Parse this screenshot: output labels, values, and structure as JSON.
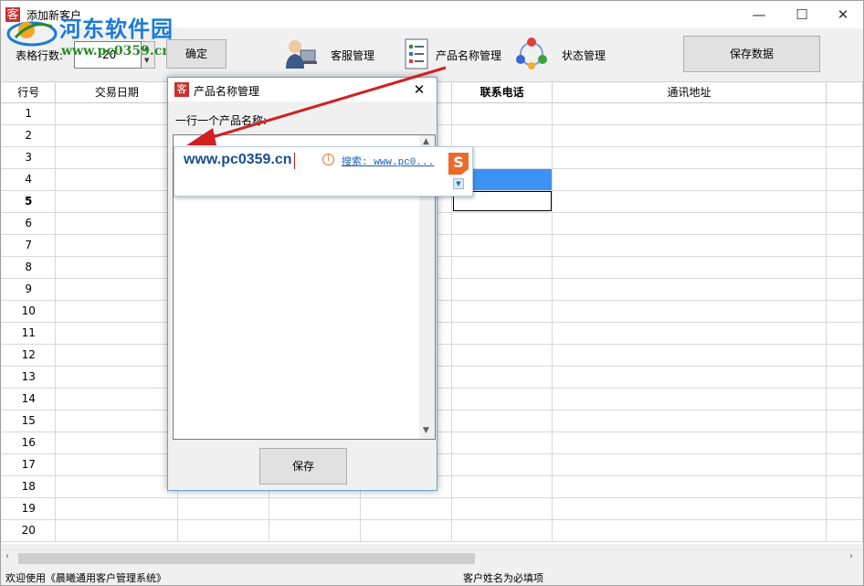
{
  "window": {
    "title": "添加新客户",
    "app_icon": "客",
    "minimize": "—",
    "maximize": "☐",
    "close": "✕"
  },
  "watermark": {
    "site_name": "河东软件园",
    "url": "www.pc0359.cn"
  },
  "toolbar": {
    "rows_label": "表格行数:",
    "rows_value": "20",
    "confirm_label": "确定",
    "customer_service_label": "客服管理",
    "product_name_label": "产品名称管理",
    "status_label": "状态管理",
    "save_data_label": "保存数据"
  },
  "grid": {
    "columns": [
      "行号",
      "交易日期",
      "",
      "",
      "",
      "联系电话",
      "通讯地址",
      ""
    ],
    "rows": [
      "1",
      "2",
      "3",
      "4",
      "5",
      "6",
      "7",
      "8",
      "9",
      "10",
      "11",
      "12",
      "13",
      "14",
      "15",
      "16",
      "17",
      "18",
      "19",
      "20"
    ]
  },
  "statusbar": {
    "left": "欢迎使用《晨曦通用客户管理系统》",
    "middle": "客户姓名为必填项"
  },
  "dialog": {
    "title": "产品名称管理",
    "icon": "客",
    "close": "✕",
    "label": "一行一个产品名称:",
    "save_label": "保存"
  },
  "ime": {
    "typed_text": "www.pc0359.cn",
    "info_icon": "i",
    "search_text": "搜索: www.pc0...",
    "logo_letter": "S",
    "dropdown": "▼"
  },
  "colors": {
    "selected_cell": "#3d93f5",
    "arrow": "#d02020",
    "watermark_blue": "#1a7bd6",
    "watermark_green": "#2a8a2a"
  }
}
